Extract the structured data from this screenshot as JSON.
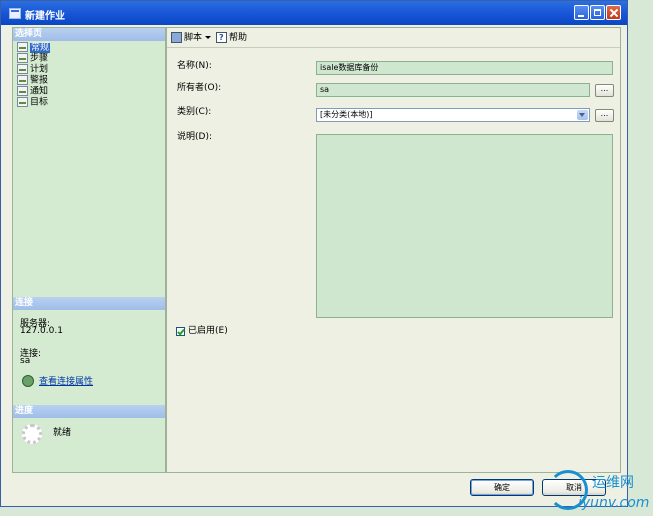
{
  "window": {
    "title": "新建作业"
  },
  "left_panel": {
    "select_page_header": "选择页",
    "pages": [
      {
        "label": "常规",
        "selected": true
      },
      {
        "label": "步骤",
        "selected": false
      },
      {
        "label": "计划",
        "selected": false
      },
      {
        "label": "警报",
        "selected": false
      },
      {
        "label": "通知",
        "selected": false
      },
      {
        "label": "目标",
        "selected": false
      }
    ],
    "connection_header": "连接",
    "server_label": "服务器:",
    "server_value": "127.0.0.1",
    "connection_label": "连接:",
    "connection_value": "sa",
    "view_connection_link": "查看连接属性",
    "progress_header": "进度",
    "progress_status": "就绪"
  },
  "toolbar": {
    "script_label": "脚本",
    "help_label": "帮助"
  },
  "form": {
    "name_label": "名称(N):",
    "name_value": "isale数据库备份",
    "owner_label": "所有者(O):",
    "owner_value": "sa",
    "category_label": "类别(C):",
    "category_value": "[未分类(本地)]",
    "description_label": "说明(D):",
    "description_value": "",
    "browse_label": "...",
    "enabled_label": "已启用(E)",
    "enabled": true
  },
  "buttons": {
    "ok_label": "确定",
    "cancel_label": "取消"
  },
  "watermark": {
    "line1": "运维网",
    "line2": "iyunv.com"
  }
}
